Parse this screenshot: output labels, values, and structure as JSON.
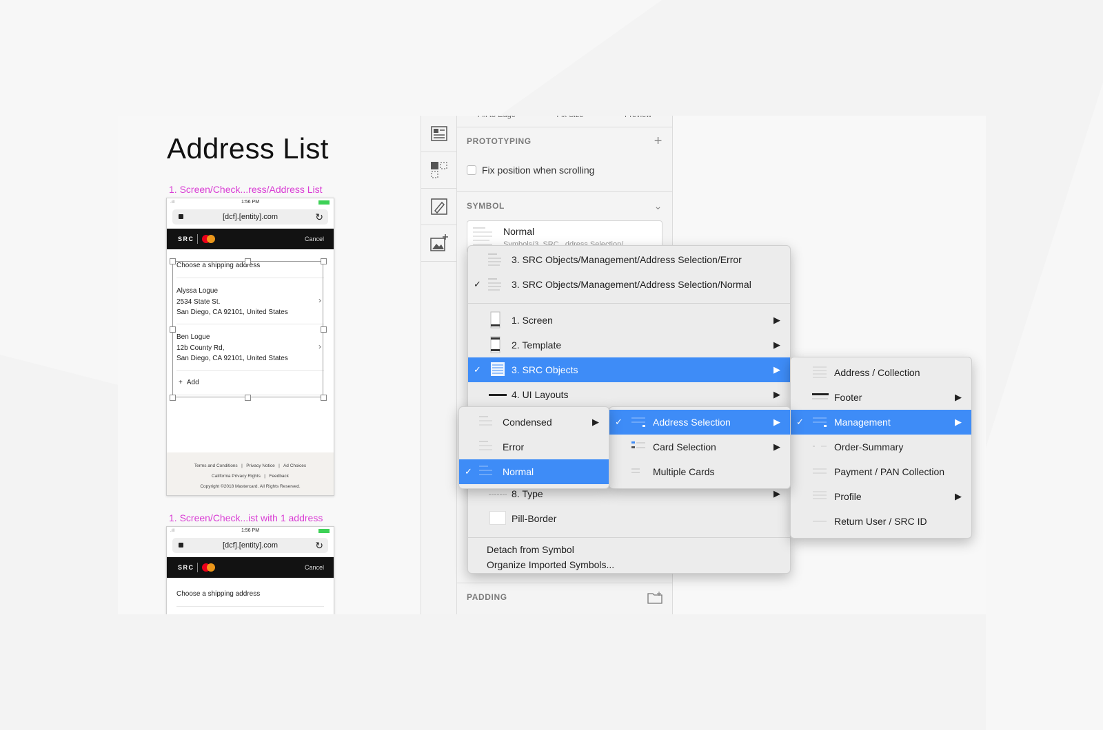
{
  "artboard": {
    "title": "Address List",
    "label_1": "1. Screen/Check...ress/Address List",
    "label_2": "1. Screen/Check...ist with 1 address"
  },
  "phone": {
    "time": "1:56 PM",
    "url": "[dcf].[entity].com",
    "src_label": "SRC",
    "cancel": "Cancel",
    "heading": "Choose a shipping address",
    "addresses": [
      {
        "name": "Alyssa Logue",
        "line1": "2534 State St.",
        "line2": "San Diego, CA 92101, United States"
      },
      {
        "name": "Ben Logue",
        "line1": "12b County Rd,",
        "line2": "San Diego, CA 92101, United States"
      }
    ],
    "add_label": "Add",
    "footer": {
      "links_1": [
        "Terms and Conditions",
        "Privacy Notice",
        "Ad Choices"
      ],
      "links_2": [
        "California Privacy Rights",
        "Feedback"
      ],
      "copyright": "Copyright ©2018 Mastercard. All Rights Reserved."
    },
    "colors": {
      "mc_red": "#eb001b",
      "mc_orange": "#f79e1b"
    }
  },
  "inspector": {
    "top_options": [
      "Fill to Edge",
      "Fix Size",
      "Preview"
    ],
    "prototyping": "PROTOTYPING",
    "fix_position": "Fix position when scrolling",
    "symbol": "SYMBOL",
    "symbol_name": "Normal",
    "symbol_path": "Symbols/3. SRC...ddress Selection/...",
    "padding": "PADDING"
  },
  "menu_main": {
    "recent": [
      {
        "label": "3. SRC Objects/Management/Address Selection/Error",
        "checked": false
      },
      {
        "label": "3. SRC Objects/Management/Address Selection/Normal",
        "checked": true
      }
    ],
    "items": [
      {
        "label": "1. Screen",
        "submenu": true
      },
      {
        "label": "2. Template",
        "submenu": true
      },
      {
        "label": "3. SRC Objects",
        "submenu": true,
        "selected": true
      },
      {
        "label": "4. UI Layouts",
        "submenu": true
      },
      {
        "label": "8. Type",
        "submenu": true
      },
      {
        "label": "Pill-Border",
        "submenu": false
      }
    ],
    "actions": [
      "Detach from Symbol",
      "Organize Imported Symbols..."
    ]
  },
  "menu_src_objects": {
    "items": [
      {
        "label": "Address / Collection",
        "submenu": false
      },
      {
        "label": "Footer",
        "submenu": true
      },
      {
        "label": "Management",
        "submenu": true,
        "selected": true
      },
      {
        "label": "Order-Summary",
        "submenu": false
      },
      {
        "label": "Payment / PAN Collection",
        "submenu": false
      },
      {
        "label": "Profile",
        "submenu": true
      },
      {
        "label": "Return User / SRC ID",
        "submenu": false
      }
    ]
  },
  "menu_management": {
    "items": [
      {
        "label": "Address Selection",
        "submenu": true,
        "selected": true
      },
      {
        "label": "Card Selection",
        "submenu": true
      },
      {
        "label": "Multiple Cards",
        "submenu": false
      }
    ]
  },
  "menu_address_selection": {
    "items": [
      {
        "label": "Condensed",
        "submenu": true
      },
      {
        "label": "Error",
        "submenu": false
      },
      {
        "label": "Normal",
        "submenu": false,
        "selected": true
      }
    ]
  },
  "colors": {
    "accent": "#3e8cf7",
    "label_magenta": "#d93bd4"
  }
}
